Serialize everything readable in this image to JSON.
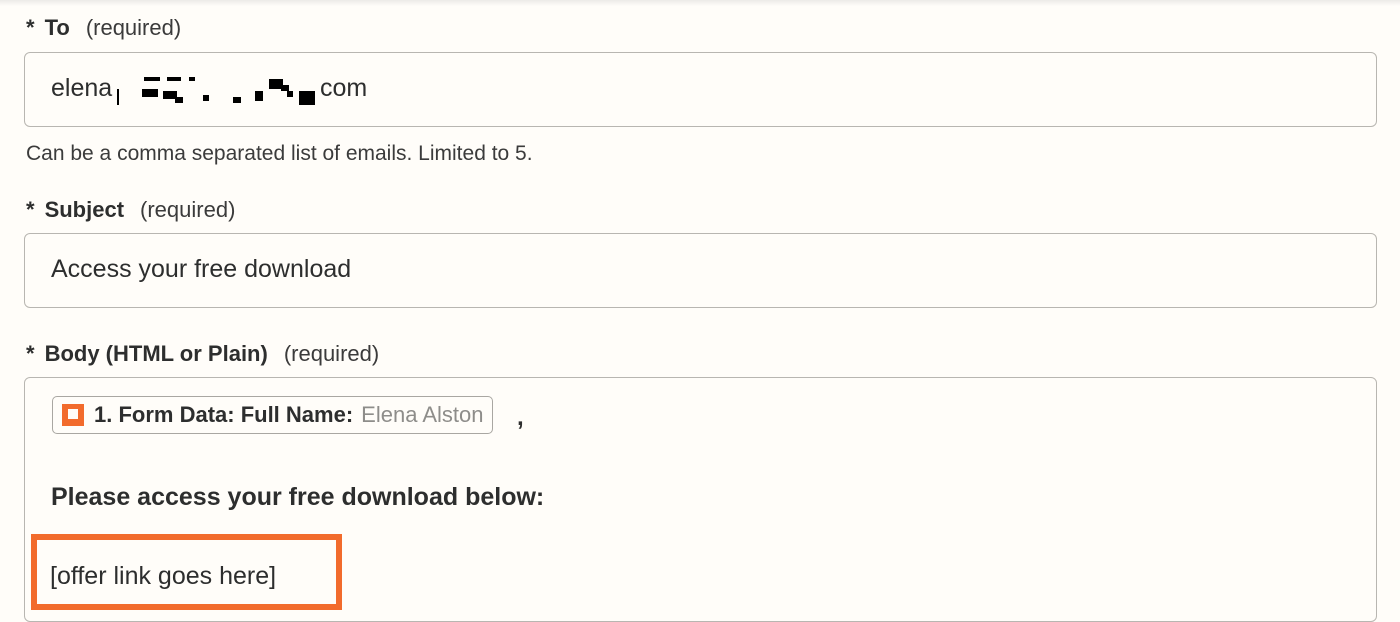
{
  "to_field": {
    "star": "*",
    "label": "To",
    "required": "(required)",
    "value_start": "elena",
    "value_end": "com",
    "help": "Can be a comma separated list of emails. Limited to 5."
  },
  "subject_field": {
    "star": "*",
    "label": "Subject",
    "required": "(required)",
    "value": "Access your free download"
  },
  "body_field": {
    "star": "*",
    "label": "Body (HTML or Plain)",
    "required": "(required)",
    "pill_key": "1. Form Data: Full Name:",
    "pill_value": "Elena Alston",
    "comma": ",",
    "line1": "Please access your free download below:",
    "line2": "[offer link goes here]"
  },
  "colors": {
    "accent": "#f26b2c",
    "background": "#fffdf9",
    "border": "#b8b6b1",
    "text": "#2d2e2e"
  },
  "icons": {
    "pill_icon": "form-app-icon"
  }
}
